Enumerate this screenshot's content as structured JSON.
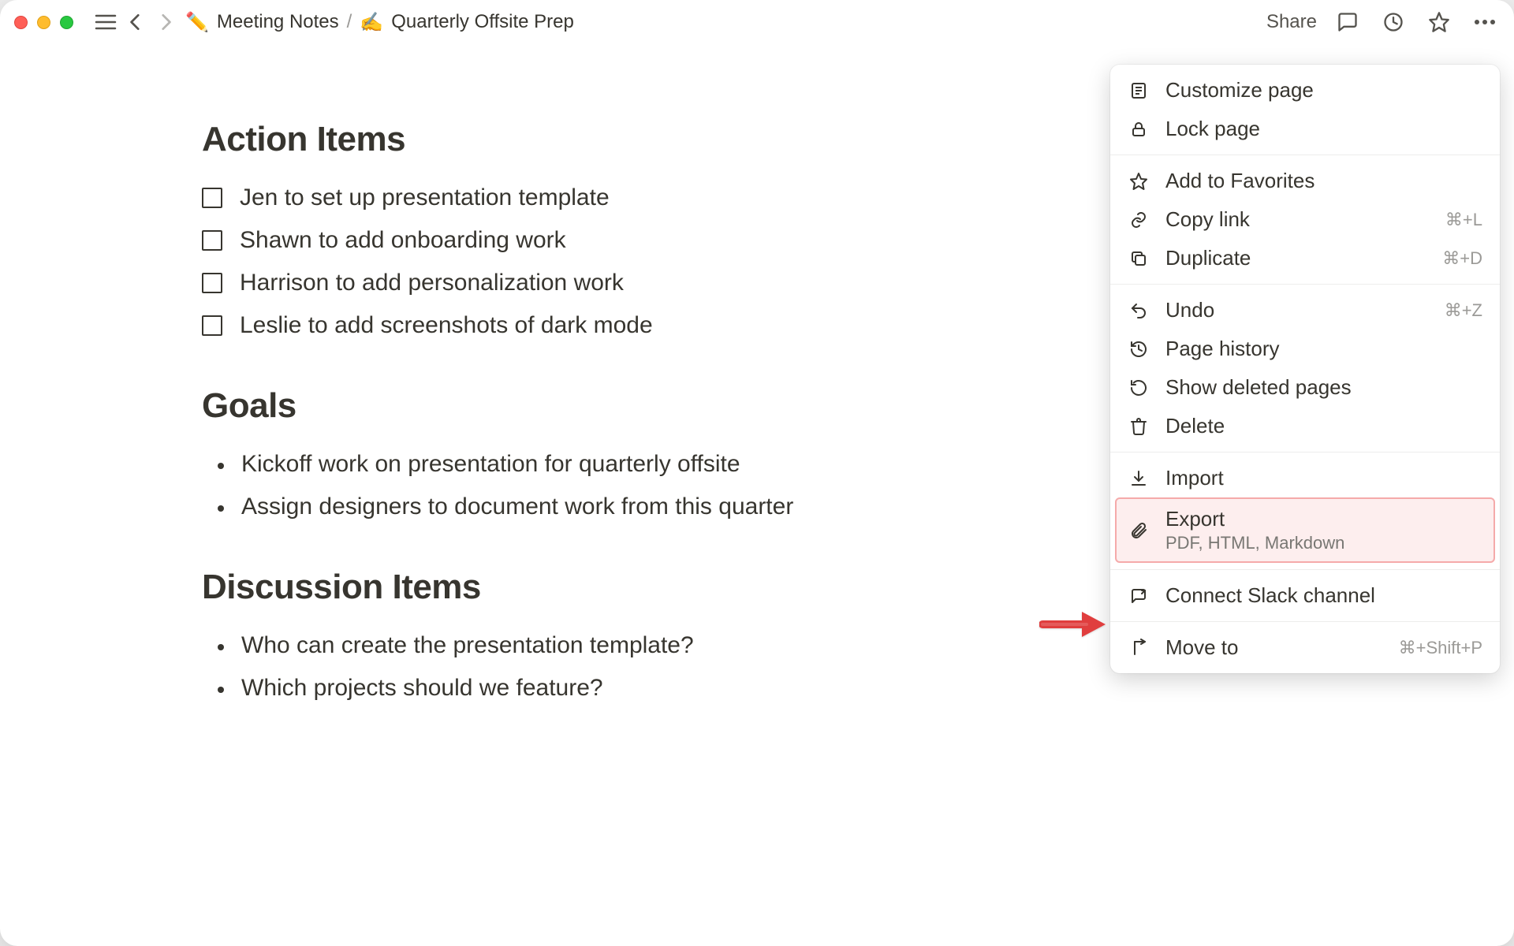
{
  "breadcrumb": {
    "parent_emoji": "✏️",
    "parent_label": "Meeting Notes",
    "page_emoji": "✍️",
    "page_label": "Quarterly Offsite Prep"
  },
  "topbar": {
    "share_label": "Share"
  },
  "sections": {
    "action_items": {
      "heading": "Action Items",
      "items": [
        "Jen to set up presentation template",
        "Shawn to add onboarding work",
        "Harrison to add personalization work",
        "Leslie to add screenshots of dark mode"
      ]
    },
    "goals": {
      "heading": "Goals",
      "items": [
        "Kickoff work on presentation for quarterly offsite",
        "Assign designers to document work from this quarter"
      ]
    },
    "discussion": {
      "heading": "Discussion Items",
      "items": [
        "Who can create the presentation template?",
        "Which projects should we feature?"
      ]
    }
  },
  "menu": {
    "customize": "Customize page",
    "lock": "Lock page",
    "favorites": "Add to Favorites",
    "copy_link": {
      "label": "Copy link",
      "shortcut": "⌘+L"
    },
    "duplicate": {
      "label": "Duplicate",
      "shortcut": "⌘+D"
    },
    "undo": {
      "label": "Undo",
      "shortcut": "⌘+Z"
    },
    "history": "Page history",
    "deleted": "Show deleted pages",
    "delete": "Delete",
    "import_": "Import",
    "export": {
      "label": "Export",
      "sub": "PDF, HTML, Markdown"
    },
    "slack": "Connect Slack channel",
    "move": {
      "label": "Move to",
      "shortcut": "⌘+Shift+P"
    }
  },
  "annotation": {
    "highlight_item": "export"
  }
}
